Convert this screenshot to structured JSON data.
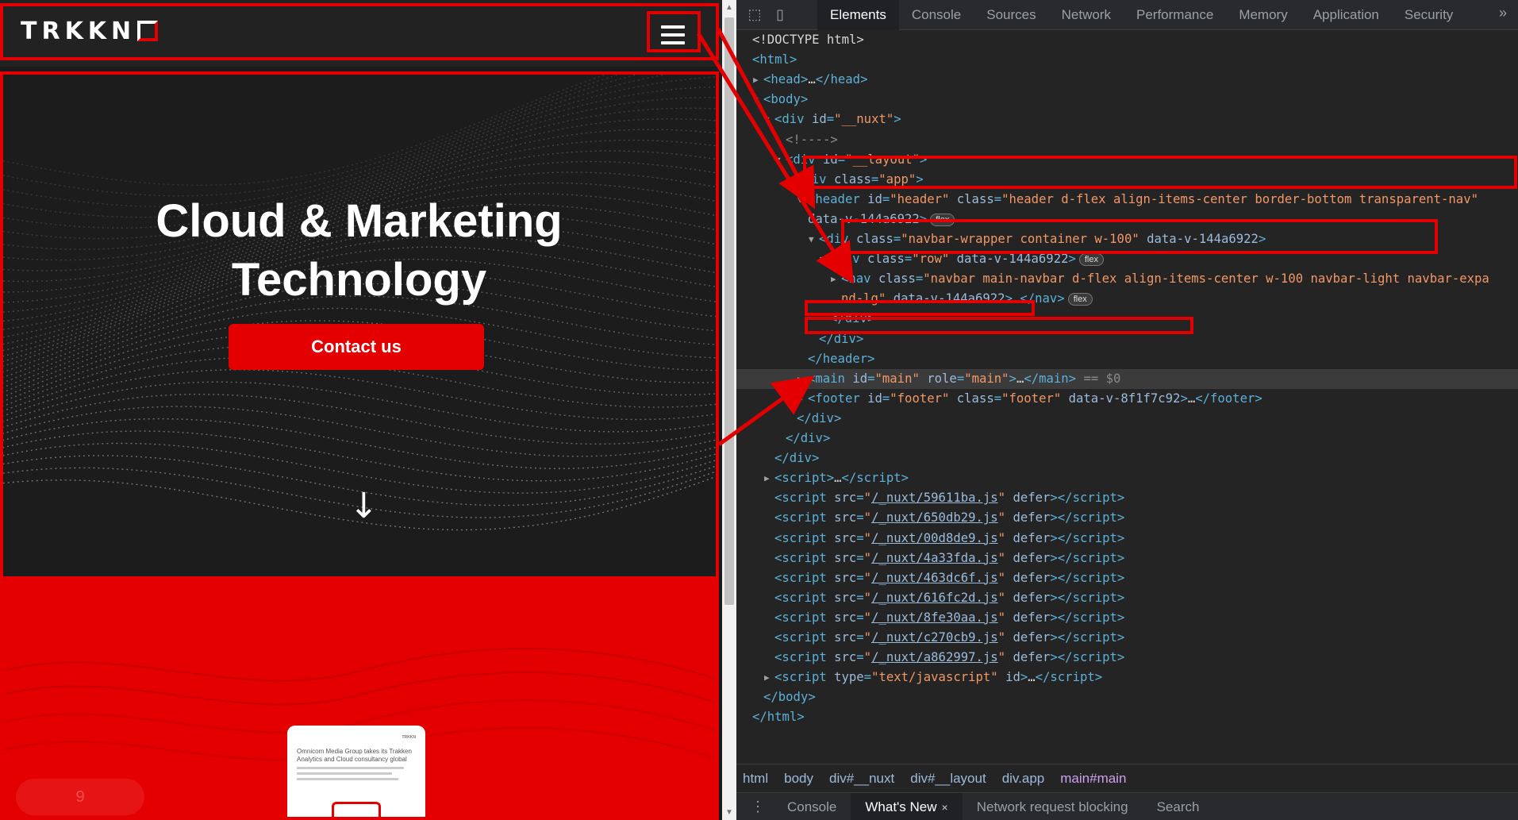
{
  "site": {
    "logo_text": "TRKKN",
    "hero_title_line1": "Cloud & Marketing",
    "hero_title_line2": "Technology",
    "contact_label": "Contact us",
    "scroll_arrow": "↓",
    "card": {
      "brand": "TRKKN",
      "headline": "Omnicom Media Group takes its Trakken Analytics and Cloud consultancy global"
    },
    "pill_text": "9"
  },
  "devtools": {
    "tabs": [
      "Elements",
      "Console",
      "Sources",
      "Network",
      "Performance",
      "Memory",
      "Application",
      "Security"
    ],
    "more": "»",
    "dom_lines": [
      {
        "indent": 0,
        "html": "<span class='txt'>&lt;!DOCTYPE html&gt;</span>"
      },
      {
        "indent": 0,
        "html": "<span class='tag'>&lt;html&gt;</span>"
      },
      {
        "indent": 1,
        "tri": "▶",
        "html": "<span class='tag'>&lt;head&gt;</span><span class='txt'>…</span><span class='tag'>&lt;/head&gt;</span>"
      },
      {
        "indent": 1,
        "tri": "▼",
        "html": "<span class='tag'>&lt;body&gt;</span>"
      },
      {
        "indent": 2,
        "tri": "▼",
        "html": "<span class='tag'>&lt;div </span><span class='attr'>id</span><span class='tag'>=</span><span class='val'>\"__nuxt\"</span><span class='tag'>&gt;</span>"
      },
      {
        "indent": 3,
        "html": "<span class='cmt'>&lt;!----&gt;</span>"
      },
      {
        "indent": 3,
        "tri": "▼",
        "html": "<span class='tag'>&lt;div </span><span class='attr'>id</span><span class='tag'>=</span><span class='val'>\"__layout\"</span><span class='tag'>&gt;</span>"
      },
      {
        "indent": 4,
        "tri": "▼",
        "html": "<span class='tag'>&lt;div </span><span class='attr'>class</span><span class='tag'>=</span><span class='val'>\"app\"</span><span class='tag'>&gt;</span>"
      },
      {
        "indent": 5,
        "tri": "▼",
        "html": "<span class='tag'>&lt;header </span><span class='attr'>id</span><span class='tag'>=</span><span class='val'>\"header\"</span> <span class='attr'>class</span><span class='tag'>=</span><span class='val'>\"header d-flex align-items-center border-bottom transparent-nav\"</span>"
      },
      {
        "indent": 5,
        "html": "<span class='attr'>data-v-144a6922</span><span class='tag'>&gt;</span><span class='badge'>flex</span>"
      },
      {
        "indent": 6,
        "tri": "▼",
        "html": "<span class='tag'>&lt;div </span><span class='attr'>class</span><span class='tag'>=</span><span class='val'>\"navbar-wrapper container w-100\"</span> <span class='attr'>data-v-144a6922</span><span class='tag'>&gt;</span>"
      },
      {
        "indent": 7,
        "tri": "▼",
        "html": "<span class='tag'>&lt;div </span><span class='attr'>class</span><span class='tag'>=</span><span class='val'>\"row\"</span> <span class='attr'>data-v-144a6922</span><span class='tag'>&gt;</span><span class='badge'>flex</span>"
      },
      {
        "indent": 8,
        "tri": "▶",
        "html": "<span class='tag'>&lt;nav </span><span class='attr'>class</span><span class='tag'>=</span><span class='val'>\"navbar main-navbar d-flex align-items-center w-100 navbar-light navbar-expa</span>"
      },
      {
        "indent": 8,
        "html": "<span class='val'>nd-lg\"</span> <span class='attr'>data-v-144a6922</span><span class='tag'>&gt;</span><span class='txt'>…</span><span class='tag'>&lt;/nav&gt;</span><span class='badge'>flex</span>"
      },
      {
        "indent": 7,
        "html": "<span class='tag'>&lt;/div&gt;</span>"
      },
      {
        "indent": 6,
        "html": "<span class='tag'>&lt;/div&gt;</span>"
      },
      {
        "indent": 5,
        "html": "<span class='tag'>&lt;/header&gt;</span>"
      },
      {
        "indent": 5,
        "tri": "▶",
        "sel": true,
        "html": "<span class='tag'>&lt;main </span><span class='attr'>id</span><span class='tag'>=</span><span class='val'>\"main\"</span> <span class='attr'>role</span><span class='tag'>=</span><span class='val'>\"main\"</span><span class='tag'>&gt;</span><span class='txt'>…</span><span class='tag'>&lt;/main&gt;</span> <span class='cmt'>== $0</span>"
      },
      {
        "indent": 5,
        "tri": "▶",
        "html": "<span class='tag'>&lt;footer </span><span class='attr'>id</span><span class='tag'>=</span><span class='val'>\"footer\"</span> <span class='attr'>class</span><span class='tag'>=</span><span class='val'>\"footer\"</span> <span class='attr'>data-v-8f1f7c92</span><span class='tag'>&gt;</span><span class='txt'>…</span><span class='tag'>&lt;/footer&gt;</span>"
      },
      {
        "indent": 4,
        "html": "<span class='tag'>&lt;/div&gt;</span>"
      },
      {
        "indent": 3,
        "html": "<span class='tag'>&lt;/div&gt;</span>"
      },
      {
        "indent": 2,
        "html": "<span class='tag'>&lt;/div&gt;</span>"
      },
      {
        "indent": 2,
        "tri": "▶",
        "html": "<span class='tag'>&lt;script&gt;</span><span class='txt'>…</span><span class='tag'>&lt;/script&gt;</span>"
      },
      {
        "indent": 2,
        "html": "<span class='tag'>&lt;script </span><span class='attr'>src</span><span class='tag'>=</span><span class='val'>\"</span><span class='link'>/_nuxt/59611ba.js</span><span class='val'>\"</span> <span class='attr'>defer</span><span class='tag'>&gt;&lt;/script&gt;</span>"
      },
      {
        "indent": 2,
        "html": "<span class='tag'>&lt;script </span><span class='attr'>src</span><span class='tag'>=</span><span class='val'>\"</span><span class='link'>/_nuxt/650db29.js</span><span class='val'>\"</span> <span class='attr'>defer</span><span class='tag'>&gt;&lt;/script&gt;</span>"
      },
      {
        "indent": 2,
        "html": "<span class='tag'>&lt;script </span><span class='attr'>src</span><span class='tag'>=</span><span class='val'>\"</span><span class='link'>/_nuxt/00d8de9.js</span><span class='val'>\"</span> <span class='attr'>defer</span><span class='tag'>&gt;&lt;/script&gt;</span>"
      },
      {
        "indent": 2,
        "html": "<span class='tag'>&lt;script </span><span class='attr'>src</span><span class='tag'>=</span><span class='val'>\"</span><span class='link'>/_nuxt/4a33fda.js</span><span class='val'>\"</span> <span class='attr'>defer</span><span class='tag'>&gt;&lt;/script&gt;</span>"
      },
      {
        "indent": 2,
        "html": "<span class='tag'>&lt;script </span><span class='attr'>src</span><span class='tag'>=</span><span class='val'>\"</span><span class='link'>/_nuxt/463dc6f.js</span><span class='val'>\"</span> <span class='attr'>defer</span><span class='tag'>&gt;&lt;/script&gt;</span>"
      },
      {
        "indent": 2,
        "html": "<span class='tag'>&lt;script </span><span class='attr'>src</span><span class='tag'>=</span><span class='val'>\"</span><span class='link'>/_nuxt/616fc2d.js</span><span class='val'>\"</span> <span class='attr'>defer</span><span class='tag'>&gt;&lt;/script&gt;</span>"
      },
      {
        "indent": 2,
        "html": "<span class='tag'>&lt;script </span><span class='attr'>src</span><span class='tag'>=</span><span class='val'>\"</span><span class='link'>/_nuxt/8fe30aa.js</span><span class='val'>\"</span> <span class='attr'>defer</span><span class='tag'>&gt;&lt;/script&gt;</span>"
      },
      {
        "indent": 2,
        "html": "<span class='tag'>&lt;script </span><span class='attr'>src</span><span class='tag'>=</span><span class='val'>\"</span><span class='link'>/_nuxt/c270cb9.js</span><span class='val'>\"</span> <span class='attr'>defer</span><span class='tag'>&gt;&lt;/script&gt;</span>"
      },
      {
        "indent": 2,
        "html": "<span class='tag'>&lt;script </span><span class='attr'>src</span><span class='tag'>=</span><span class='val'>\"</span><span class='link'>/_nuxt/a862997.js</span><span class='val'>\"</span> <span class='attr'>defer</span><span class='tag'>&gt;&lt;/script&gt;</span>"
      },
      {
        "indent": 2,
        "tri": "▶",
        "html": "<span class='tag'>&lt;script </span><span class='attr'>type</span><span class='tag'>=</span><span class='val'>\"text/javascript\"</span> <span class='attr'>id</span><span class='tag'>&gt;</span><span class='txt'>…</span><span class='tag'>&lt;/script&gt;</span>"
      },
      {
        "indent": 1,
        "html": "<span class='tag'>&lt;/body&gt;</span>"
      },
      {
        "indent": 0,
        "html": "<span class='tag'>&lt;/html&gt;</span>"
      }
    ],
    "breadcrumbs": [
      "html",
      "body",
      "div#__nuxt",
      "div#__layout",
      "div.app",
      "main#main"
    ],
    "drawer_tabs": [
      "Console",
      "What's New",
      "Network request blocking",
      "Search"
    ],
    "drawer_close": "×"
  },
  "colors": {
    "accent": "#e40000"
  }
}
